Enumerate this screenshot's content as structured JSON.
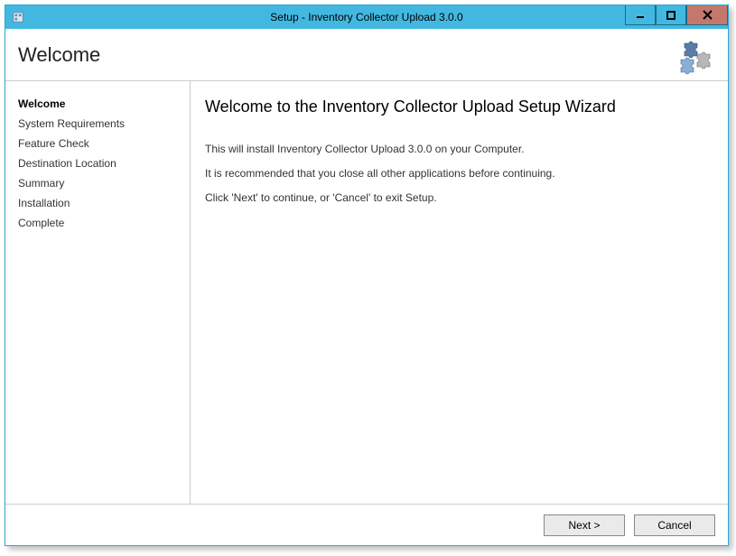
{
  "window": {
    "title": "Setup - Inventory Collector Upload 3.0.0"
  },
  "header": {
    "title": "Welcome"
  },
  "sidebar": {
    "items": [
      {
        "label": "Welcome",
        "active": true
      },
      {
        "label": "System Requirements",
        "active": false
      },
      {
        "label": "Feature Check",
        "active": false
      },
      {
        "label": "Destination Location",
        "active": false
      },
      {
        "label": "Summary",
        "active": false
      },
      {
        "label": "Installation",
        "active": false
      },
      {
        "label": "Complete",
        "active": false
      }
    ]
  },
  "main": {
    "heading": "Welcome to the Inventory Collector Upload Setup Wizard",
    "line1": "This will install Inventory Collector Upload 3.0.0 on your Computer.",
    "line2": "It is recommended that you close all other applications before continuing.",
    "line3": "Click 'Next' to continue, or 'Cancel' to exit Setup."
  },
  "footer": {
    "next_label": "Next >",
    "cancel_label": "Cancel"
  }
}
